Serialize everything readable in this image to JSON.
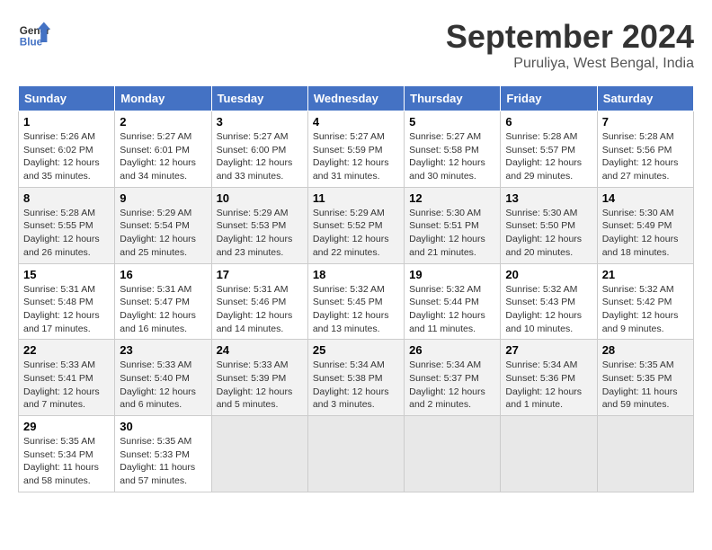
{
  "header": {
    "logo_line1": "General",
    "logo_line2": "Blue",
    "month": "September 2024",
    "location": "Puruliya, West Bengal, India"
  },
  "weekdays": [
    "Sunday",
    "Monday",
    "Tuesday",
    "Wednesday",
    "Thursday",
    "Friday",
    "Saturday"
  ],
  "weeks": [
    [
      {
        "day": "1",
        "info": "Sunrise: 5:26 AM\nSunset: 6:02 PM\nDaylight: 12 hours\nand 35 minutes."
      },
      {
        "day": "2",
        "info": "Sunrise: 5:27 AM\nSunset: 6:01 PM\nDaylight: 12 hours\nand 34 minutes."
      },
      {
        "day": "3",
        "info": "Sunrise: 5:27 AM\nSunset: 6:00 PM\nDaylight: 12 hours\nand 33 minutes."
      },
      {
        "day": "4",
        "info": "Sunrise: 5:27 AM\nSunset: 5:59 PM\nDaylight: 12 hours\nand 31 minutes."
      },
      {
        "day": "5",
        "info": "Sunrise: 5:27 AM\nSunset: 5:58 PM\nDaylight: 12 hours\nand 30 minutes."
      },
      {
        "day": "6",
        "info": "Sunrise: 5:28 AM\nSunset: 5:57 PM\nDaylight: 12 hours\nand 29 minutes."
      },
      {
        "day": "7",
        "info": "Sunrise: 5:28 AM\nSunset: 5:56 PM\nDaylight: 12 hours\nand 27 minutes."
      }
    ],
    [
      {
        "day": "8",
        "info": "Sunrise: 5:28 AM\nSunset: 5:55 PM\nDaylight: 12 hours\nand 26 minutes."
      },
      {
        "day": "9",
        "info": "Sunrise: 5:29 AM\nSunset: 5:54 PM\nDaylight: 12 hours\nand 25 minutes."
      },
      {
        "day": "10",
        "info": "Sunrise: 5:29 AM\nSunset: 5:53 PM\nDaylight: 12 hours\nand 23 minutes."
      },
      {
        "day": "11",
        "info": "Sunrise: 5:29 AM\nSunset: 5:52 PM\nDaylight: 12 hours\nand 22 minutes."
      },
      {
        "day": "12",
        "info": "Sunrise: 5:30 AM\nSunset: 5:51 PM\nDaylight: 12 hours\nand 21 minutes."
      },
      {
        "day": "13",
        "info": "Sunrise: 5:30 AM\nSunset: 5:50 PM\nDaylight: 12 hours\nand 20 minutes."
      },
      {
        "day": "14",
        "info": "Sunrise: 5:30 AM\nSunset: 5:49 PM\nDaylight: 12 hours\nand 18 minutes."
      }
    ],
    [
      {
        "day": "15",
        "info": "Sunrise: 5:31 AM\nSunset: 5:48 PM\nDaylight: 12 hours\nand 17 minutes."
      },
      {
        "day": "16",
        "info": "Sunrise: 5:31 AM\nSunset: 5:47 PM\nDaylight: 12 hours\nand 16 minutes."
      },
      {
        "day": "17",
        "info": "Sunrise: 5:31 AM\nSunset: 5:46 PM\nDaylight: 12 hours\nand 14 minutes."
      },
      {
        "day": "18",
        "info": "Sunrise: 5:32 AM\nSunset: 5:45 PM\nDaylight: 12 hours\nand 13 minutes."
      },
      {
        "day": "19",
        "info": "Sunrise: 5:32 AM\nSunset: 5:44 PM\nDaylight: 12 hours\nand 11 minutes."
      },
      {
        "day": "20",
        "info": "Sunrise: 5:32 AM\nSunset: 5:43 PM\nDaylight: 12 hours\nand 10 minutes."
      },
      {
        "day": "21",
        "info": "Sunrise: 5:32 AM\nSunset: 5:42 PM\nDaylight: 12 hours\nand 9 minutes."
      }
    ],
    [
      {
        "day": "22",
        "info": "Sunrise: 5:33 AM\nSunset: 5:41 PM\nDaylight: 12 hours\nand 7 minutes."
      },
      {
        "day": "23",
        "info": "Sunrise: 5:33 AM\nSunset: 5:40 PM\nDaylight: 12 hours\nand 6 minutes."
      },
      {
        "day": "24",
        "info": "Sunrise: 5:33 AM\nSunset: 5:39 PM\nDaylight: 12 hours\nand 5 minutes."
      },
      {
        "day": "25",
        "info": "Sunrise: 5:34 AM\nSunset: 5:38 PM\nDaylight: 12 hours\nand 3 minutes."
      },
      {
        "day": "26",
        "info": "Sunrise: 5:34 AM\nSunset: 5:37 PM\nDaylight: 12 hours\nand 2 minutes."
      },
      {
        "day": "27",
        "info": "Sunrise: 5:34 AM\nSunset: 5:36 PM\nDaylight: 12 hours\nand 1 minute."
      },
      {
        "day": "28",
        "info": "Sunrise: 5:35 AM\nSunset: 5:35 PM\nDaylight: 11 hours\nand 59 minutes."
      }
    ],
    [
      {
        "day": "29",
        "info": "Sunrise: 5:35 AM\nSunset: 5:34 PM\nDaylight: 11 hours\nand 58 minutes."
      },
      {
        "day": "30",
        "info": "Sunrise: 5:35 AM\nSunset: 5:33 PM\nDaylight: 11 hours\nand 57 minutes."
      },
      null,
      null,
      null,
      null,
      null
    ]
  ],
  "accent_color": "#4472c4"
}
